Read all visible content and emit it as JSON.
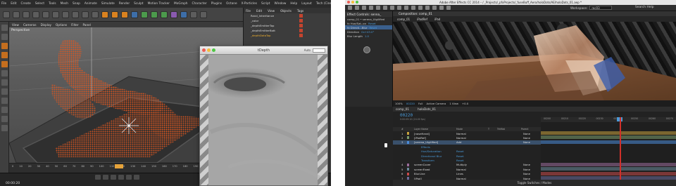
{
  "c4d": {
    "menu": [
      "File",
      "Edit",
      "Create",
      "Select",
      "Tools",
      "Mesh",
      "Snap",
      "Animate",
      "Simulate",
      "Render",
      "Sculpt",
      "Motion Tracker",
      "MoGraph",
      "Character",
      "Plugins",
      "Octane",
      "X-Particles",
      "Script",
      "Window",
      "Help",
      "Layout",
      "Tech (Cinema)"
    ],
    "object_tabs": [
      "File",
      "Edit",
      "View",
      "Objects",
      "Tags"
    ],
    "viewport_menu": [
      "View",
      "Cameras",
      "Display",
      "Options",
      "Filter",
      "Panel"
    ],
    "objects": [
      {
        "label": "Rand_Inheritance",
        "state": "plain"
      },
      {
        "label": "_color",
        "state": "plain"
      },
      {
        "label": "_depthEmitterTop",
        "state": "plain"
      },
      {
        "label": "_depthEmitterBott",
        "state": "plain"
      },
      {
        "label": "_depthDataTop",
        "state": "highlight"
      }
    ],
    "viewport_label": "Perspective",
    "timeline_ticks": [
      "0",
      "10",
      "20",
      "30",
      "40",
      "50",
      "60",
      "70",
      "80",
      "90",
      "100",
      "110",
      "120",
      "130",
      "140",
      "150",
      "160",
      "170",
      "180",
      "190",
      "200",
      "210",
      "220",
      "230"
    ],
    "timecode": "00:00:20",
    "depth_window": {
      "title": "tDepth",
      "zoom_label": "Auto"
    }
  },
  "ae": {
    "title": "Adobe After Effects CC 2014 – / _Projects/_pfxProjects/_fuseBuff_Aero/holoDots/AE/holoDots_01.aep *",
    "workspace_label": "Workspace:",
    "workspace_value": "rec03",
    "search_help": "Search Help",
    "effect_controls": {
      "tab": "Effect Controls: senna_",
      "rows": [
        {
          "label": "comp_01 • serena_Uigilified",
          "sel": false
        },
        {
          "label": "fx  Hue/Sat..on",
          "value": "Reset",
          "sel": false
        },
        {
          "label": "fx  Directi...Blur",
          "value": "Reset",
          "sel": true
        },
        {
          "label": "Direction",
          "value": "0x+43.0°",
          "sel": false
        },
        {
          "label": "Blur Length",
          "value": "1.0",
          "sel": false
        }
      ]
    },
    "composition": {
      "tab": "Composition: comp_01",
      "sub_tabs": [
        "comp_01",
        "iPadRef",
        "iPad"
      ],
      "footer": [
        "100%",
        "00220",
        "Full",
        "Active Camera",
        "1 View",
        "+0.0"
      ]
    },
    "timeline": {
      "tabs": [
        "comp_01",
        "holoDots_01"
      ],
      "timecode": "00220",
      "subcode": "0:00:09:10 (24.00 fps)",
      "headers": [
        "#",
        "Layer Name",
        "Mode",
        "T",
        "TrkMat",
        "Parent"
      ],
      "ruler": [
        "00200",
        "00210",
        "00220",
        "00230",
        "00240",
        "00250",
        "00260",
        "00270"
      ],
      "layers": [
        {
          "num": "1",
          "name": "[noseHand]",
          "mode": "Normal",
          "parent": "None",
          "color": "#c7a13c",
          "sel": false
        },
        {
          "num": "2",
          "name": "[iPadRef]",
          "mode": "Normal",
          "parent": "None",
          "color": "#7a9a6b",
          "sel": false
        },
        {
          "num": "3",
          "name": "[serena_Uigilified]",
          "mode": "Add",
          "parent": "None",
          "color": "#4a8ad8",
          "sel": true
        },
        {
          "num": "",
          "name": "Effects",
          "mode": "",
          "parent": "",
          "color": "",
          "sel": false
        },
        {
          "num": "",
          "name": "Hue/Saturation",
          "mode": "Reset",
          "parent": "",
          "color": "",
          "sel": false
        },
        {
          "num": "",
          "name": "Directional Blur",
          "mode": "Reset",
          "parent": "",
          "color": "",
          "sel": false
        },
        {
          "num": "",
          "name": "Transform",
          "mode": "Reset",
          "parent": "",
          "color": "",
          "sel": false
        },
        {
          "num": "4",
          "name": "screenCover",
          "mode": "Multiply",
          "parent": "None",
          "color": "#9a6b9a",
          "sel": false
        },
        {
          "num": "5",
          "name": "screenFixed",
          "mode": "Normal",
          "parent": "None",
          "color": "#6b8a9a",
          "sel": false
        },
        {
          "num": "6",
          "name": "BlurLine",
          "mode": "Lines",
          "parent": "None",
          "color": "#c84a4a",
          "sel": false
        },
        {
          "num": "7",
          "name": "[iPad]",
          "mode": "Normal",
          "parent": "None",
          "color": "#6b6b9a",
          "sel": false
        }
      ],
      "footer": "Toggle Switches / Modes"
    }
  }
}
